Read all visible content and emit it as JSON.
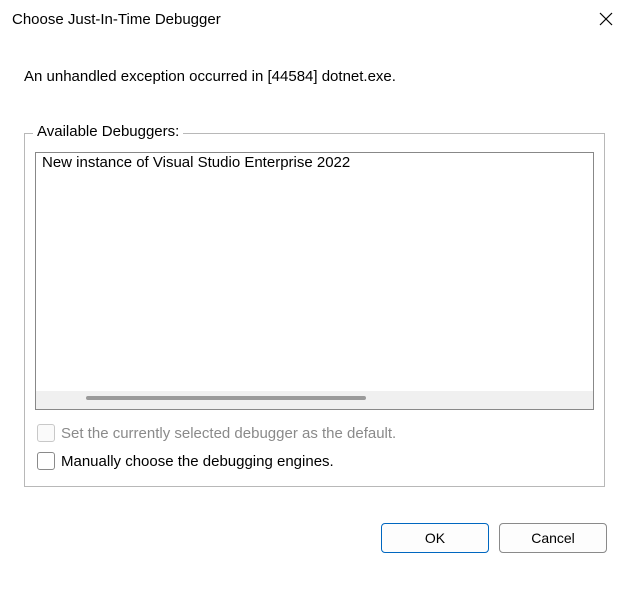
{
  "titlebar": {
    "title": "Choose Just-In-Time Debugger"
  },
  "message": "An unhandled exception occurred in [44584] dotnet.exe.",
  "debuggers_section": {
    "label": "Available Debuggers:",
    "items": [
      "New instance of Visual Studio Enterprise 2022"
    ],
    "set_default_label": "Set the currently selected debugger as the default.",
    "manual_engines_label": "Manually choose the debugging engines."
  },
  "buttons": {
    "ok": "OK",
    "cancel": "Cancel"
  }
}
